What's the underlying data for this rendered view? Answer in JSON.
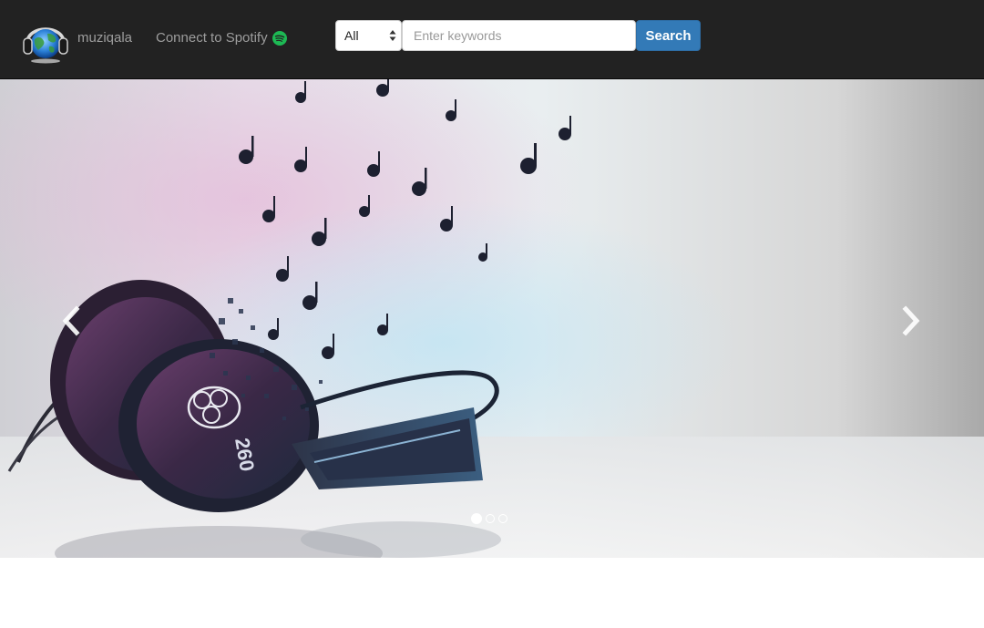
{
  "navbar": {
    "brand_name": "muziqala",
    "logo_icon": "headphones-globe-logo-icon",
    "spotify_link_label": "Connect to Spotify",
    "spotify_icon": "spotify-icon",
    "spotify_color": "#1db954",
    "background_color": "#222222",
    "text_color": "#9d9d9d"
  },
  "search": {
    "category_selected": "All",
    "placeholder": "Enter keywords",
    "value": "",
    "button_label": "Search",
    "button_color": "#337ab7"
  },
  "carousel": {
    "slide_image": "headphones-music-notes-image",
    "prev_icon": "chevron-left-icon",
    "next_icon": "chevron-right-icon",
    "slide_count": 3,
    "active_index": 0
  }
}
